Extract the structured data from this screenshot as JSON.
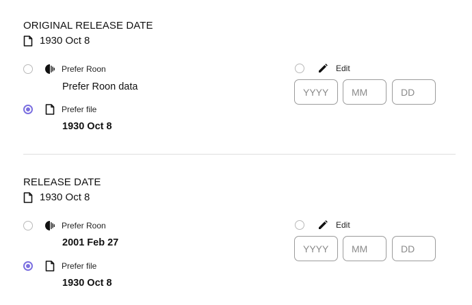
{
  "sections": [
    {
      "title": "ORIGINAL RELEASE DATE",
      "current_value": "1930 Oct 8",
      "options": [
        {
          "label": "Prefer Roon",
          "value": "Prefer Roon data",
          "selected": false
        },
        {
          "label": "Prefer file",
          "value": "1930 Oct 8",
          "selected": true
        },
        {
          "label": "Edit",
          "selected": false
        }
      ],
      "edit_placeholders": {
        "year": "YYYY",
        "month": "MM",
        "day": "DD"
      }
    },
    {
      "title": "RELEASE DATE",
      "current_value": "1930 Oct 8",
      "options": [
        {
          "label": "Prefer Roon",
          "value": "2001 Feb 27",
          "selected": false
        },
        {
          "label": "Prefer file",
          "value": "1930 Oct 8",
          "selected": true
        },
        {
          "label": "Edit",
          "selected": false
        }
      ],
      "edit_placeholders": {
        "year": "YYYY",
        "month": "MM",
        "day": "DD"
      }
    }
  ],
  "colors": {
    "accent": "#7b6fe0",
    "divider": "#dddddd",
    "border": "#9a9a9a"
  },
  "icons": {
    "file": "document-icon",
    "roon": "roon-logo-icon",
    "edit": "pencil-icon"
  }
}
